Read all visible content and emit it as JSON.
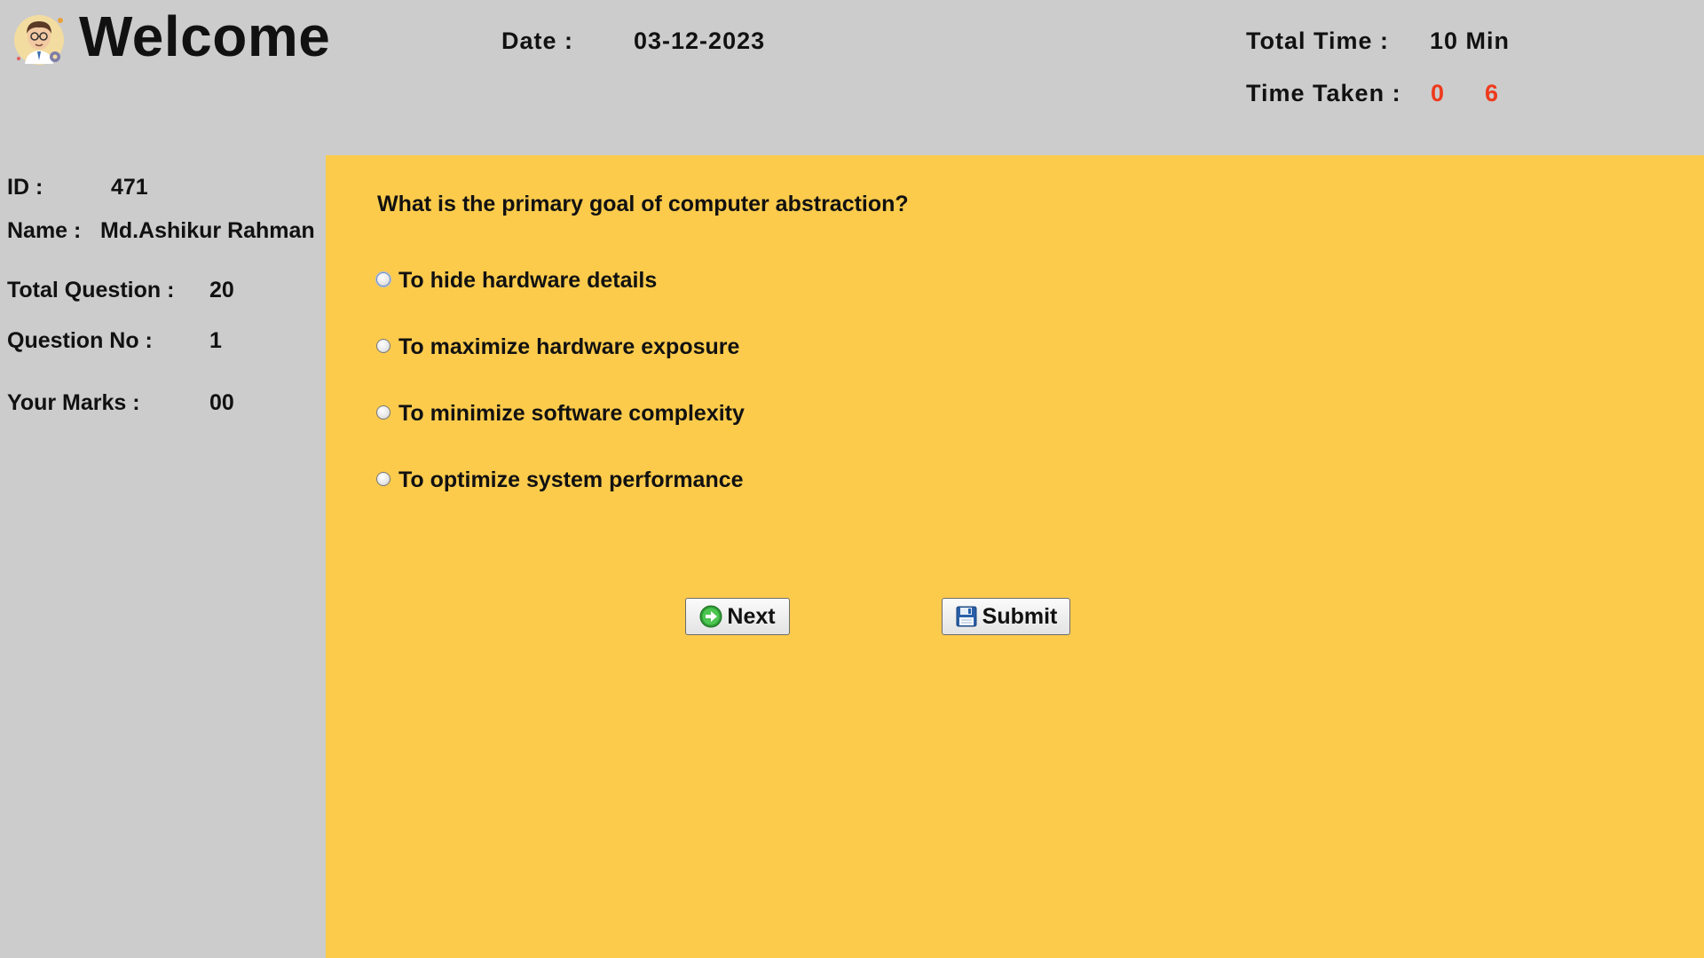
{
  "header": {
    "title": "Welcome",
    "date_label": "Date :",
    "date_value": "03-12-2023",
    "total_time_label": "Total Time :",
    "total_time_value": "10 Min",
    "time_taken_label": "Time Taken :",
    "time_taken_min": "0",
    "time_taken_sec": "6"
  },
  "sidebar": {
    "id_label": "ID :",
    "id_value": "471",
    "name_label": "Name :",
    "name_value": "Md.Ashikur Rahman",
    "total_question_label": "Total Question :",
    "total_question_value": "20",
    "question_no_label": "Question No :",
    "question_no_value": "1",
    "marks_label": "Your Marks :",
    "marks_value": "00"
  },
  "quiz": {
    "question": "What is the primary goal of computer abstraction?",
    "options": [
      "To hide hardware details",
      "To maximize hardware exposure",
      "To minimize software complexity",
      "To optimize system performance"
    ],
    "next_label": "Next",
    "submit_label": "Submit"
  },
  "colors": {
    "panel_bg": "#fccb4c",
    "page_bg": "#cccccc",
    "timer_color": "#ee3a1c"
  },
  "icons": {
    "avatar": "user-avatar-icon",
    "next": "green-arrow-right-icon",
    "submit": "floppy-disk-save-icon"
  }
}
